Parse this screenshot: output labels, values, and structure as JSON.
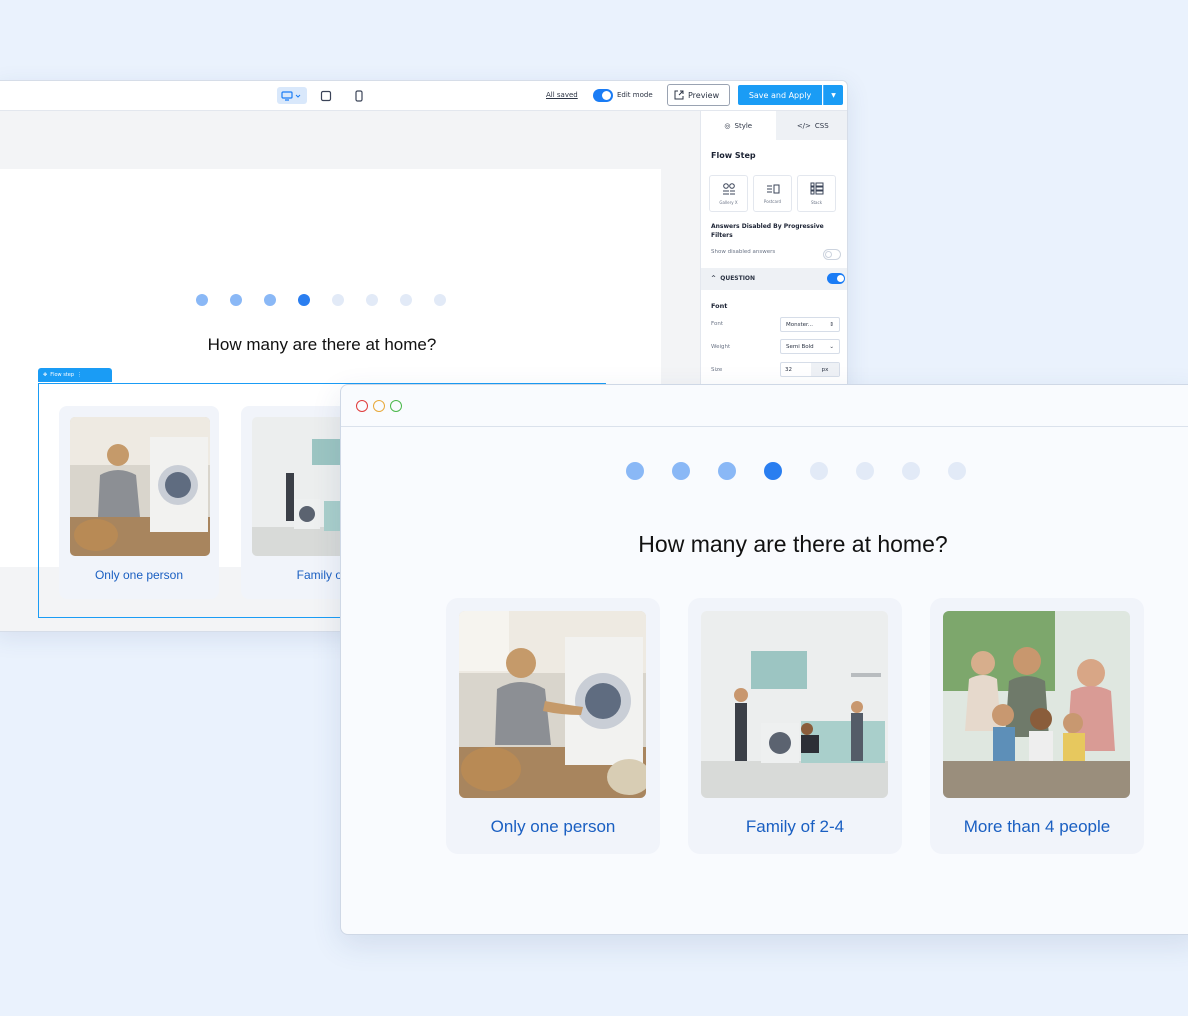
{
  "editor": {
    "toolbar": {
      "devices": [
        "desktop-icon",
        "tablet-icon",
        "phone-icon"
      ],
      "saved_status": "All saved",
      "edit_mode_label": "Edit mode",
      "edit_mode_on": true,
      "preview_label": "Preview",
      "save_label": "Save and Apply"
    },
    "canvas": {
      "progress_total": 8,
      "progress_current": 4,
      "question": "How many are there at home?",
      "flow_tag": "Flow step",
      "answers": [
        "Only one person",
        "Family of"
      ]
    },
    "panel": {
      "tabs": [
        "Style",
        "CSS"
      ],
      "heading": "Flow Step",
      "layouts": [
        "Gallery X",
        "Postcard",
        "Stack"
      ],
      "answers_disabled_title": "Answers Disabled By Progressive Filters",
      "show_disabled_label": "Show disabled answers",
      "question_section": "QUESTION",
      "font_heading": "Font",
      "font_label": "Font",
      "font_value": "Monster...",
      "weight_label": "Weight",
      "weight_value": "Semi Bold",
      "size_label": "Size",
      "size_value": "32",
      "size_unit": "px"
    }
  },
  "preview": {
    "progress_total": 8,
    "progress_current": 4,
    "question": "How many are there at home?",
    "answers": [
      "Only one person",
      "Family of 2-4",
      "More than 4 people"
    ]
  },
  "colors": {
    "page_bg": "#eaf2fd",
    "accent": "#1a7cf5",
    "dot_done": "#8ab8f6",
    "dot_current": "#2a7ef0",
    "dot_pending": "#e2eaf7",
    "answer_text": "#1a5fc2"
  }
}
